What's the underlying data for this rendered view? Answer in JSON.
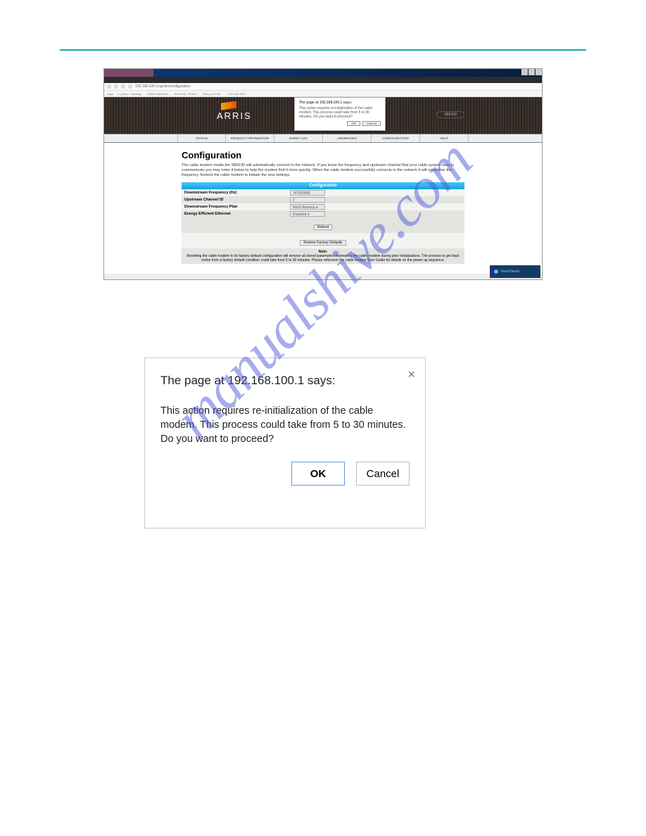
{
  "browser": {
    "url": "192.168.100.1/cgi-bin/configuration",
    "bookmarks": [
      "Apps",
      "[+] Inbox - webadg...",
      "ARRIS MIB Man...",
      "IPv6 test - IPv6/4...",
      "Test your IPv6",
      "→ 192.168.100.1"
    ]
  },
  "brand": {
    "name": "ARRIS",
    "model": "SB6190"
  },
  "nav": [
    "STATUS",
    "PRODUCT INFORMATION",
    "EVENT LOG",
    "ADDRESSES",
    "CONFIGURATION",
    "HELP"
  ],
  "page": {
    "title": "Configuration",
    "desc": "The cable modem inside the SB6190 will automatically connect to the network. If you know the frequency and upstream channel that your cable system uses to communicate you may enter it below to help the modem find it more quickly. When the cable modem successfully connects to the network it will remember the frequency. Reboot the cable modem to initiate the new settings.",
    "section_label": "Configuration",
    "rows": [
      {
        "label": "Downstream Frequency (Hz)",
        "value": "747000000"
      },
      {
        "label": "Upstream Channel ID",
        "value": "1"
      },
      {
        "label": "Downstream Frequency Plan",
        "value": "North America ▾"
      },
      {
        "label": "Energy Efficient Ethernet",
        "value": "Disabled ▾"
      }
    ],
    "reboot_label": "Reboot",
    "restore_label": "Restore Factory Defaults",
    "note_heading": "Note:",
    "note_text": "Resetting the cable modem to its factory default configuration will remove all stored parameters learned by the cable modem during prior initializations. The process to get back online from a factory default condition could take from 5 to 30 minutes. Please reference the cable modem User Guide for details on the power up sequence."
  },
  "small_dialog": {
    "title": "The page at 192.168.100.1 says:",
    "msg": "This action requires re-initialization of the cable modem. This process could take from 5 to 30 minutes. Do you want to proceed?",
    "ok": "OK",
    "cancel": "Cancel"
  },
  "big_dialog": {
    "title": "The page at 192.168.100.1 says:",
    "msg": "This action requires re-initialization of the cable modem. This process could take from 5 to 30 minutes.  Do you want to proceed?",
    "ok": "OK",
    "cancel": "Cancel"
  },
  "teamviewer": "TeamViewer",
  "watermark": "manualshive.com"
}
